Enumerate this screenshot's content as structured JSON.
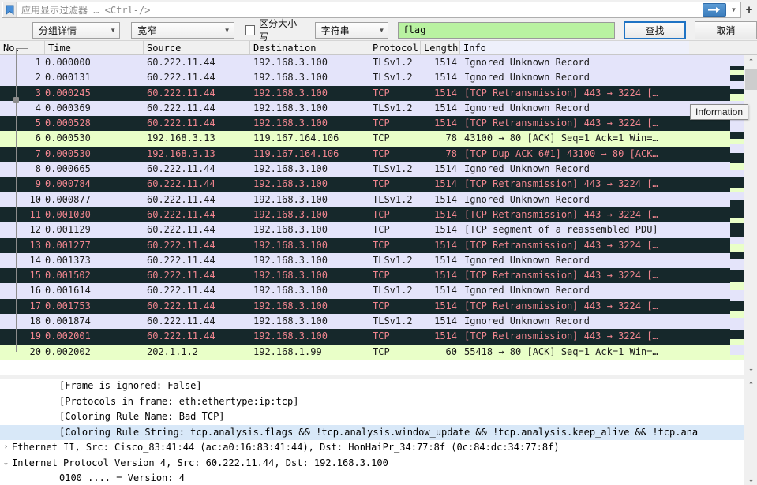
{
  "filter_bar": {
    "placeholder": "应用显示过滤器 … <Ctrl-/>",
    "bookmark_icon": "bookmark-icon",
    "apply_icon": "arrow-right-icon",
    "caret_icon": "chevron-down-icon",
    "plus_label": "+"
  },
  "find_bar": {
    "search_in": "分组详情",
    "search_width": "宽窄",
    "case_label": "区分大小写",
    "value_type": "字符串",
    "query": "flag",
    "find_label": "查找",
    "cancel_label": "取消",
    "chevron": "⌄"
  },
  "columns": {
    "no": "No.",
    "time": "Time",
    "source": "Source",
    "destination": "Destination",
    "protocol": "Protocol",
    "length": "Length",
    "info": "Info"
  },
  "tooltip": {
    "text": "Information"
  },
  "packets": [
    {
      "no": "1",
      "time": "0.000000",
      "src": "60.222.11.44",
      "dst": "192.168.3.100",
      "proto": "TLSv1.2",
      "len": "1514",
      "info": "Ignored Unknown Record",
      "style": "row-tls"
    },
    {
      "no": "2",
      "time": "0.000131",
      "src": "60.222.11.44",
      "dst": "192.168.3.100",
      "proto": "TLSv1.2",
      "len": "1514",
      "info": "Ignored Unknown Record",
      "style": "row-tls"
    },
    {
      "no": "3",
      "time": "0.000245",
      "src": "60.222.11.44",
      "dst": "192.168.3.100",
      "proto": "TCP",
      "len": "1514",
      "info": "[TCP Retransmission] 443 → 3224 […",
      "style": "row-bad"
    },
    {
      "no": "4",
      "time": "0.000369",
      "src": "60.222.11.44",
      "dst": "192.168.3.100",
      "proto": "TLSv1.2",
      "len": "1514",
      "info": "Ignored Unknown Record",
      "style": "row-tls"
    },
    {
      "no": "5",
      "time": "0.000528",
      "src": "60.222.11.44",
      "dst": "192.168.3.100",
      "proto": "TCP",
      "len": "1514",
      "info": "[TCP Retransmission] 443 → 3224 […",
      "style": "row-bad"
    },
    {
      "no": "6",
      "time": "0.000530",
      "src": "192.168.3.13",
      "dst": "119.167.164.106",
      "proto": "TCP",
      "len": "78",
      "info": "43100 → 80 [ACK] Seq=1 Ack=1 Win=…",
      "style": "row-good"
    },
    {
      "no": "7",
      "time": "0.000530",
      "src": "192.168.3.13",
      "dst": "119.167.164.106",
      "proto": "TCP",
      "len": "78",
      "info": "[TCP Dup ACK 6#1] 43100 → 80 [ACK…",
      "style": "row-bad"
    },
    {
      "no": "8",
      "time": "0.000665",
      "src": "60.222.11.44",
      "dst": "192.168.3.100",
      "proto": "TLSv1.2",
      "len": "1514",
      "info": "Ignored Unknown Record",
      "style": "row-tls"
    },
    {
      "no": "9",
      "time": "0.000784",
      "src": "60.222.11.44",
      "dst": "192.168.3.100",
      "proto": "TCP",
      "len": "1514",
      "info": "[TCP Retransmission] 443 → 3224 […",
      "style": "row-bad"
    },
    {
      "no": "10",
      "time": "0.000877",
      "src": "60.222.11.44",
      "dst": "192.168.3.100",
      "proto": "TLSv1.2",
      "len": "1514",
      "info": "Ignored Unknown Record",
      "style": "row-tls"
    },
    {
      "no": "11",
      "time": "0.001030",
      "src": "60.222.11.44",
      "dst": "192.168.3.100",
      "proto": "TCP",
      "len": "1514",
      "info": "[TCP Retransmission] 443 → 3224 […",
      "style": "row-bad"
    },
    {
      "no": "12",
      "time": "0.001129",
      "src": "60.222.11.44",
      "dst": "192.168.3.100",
      "proto": "TCP",
      "len": "1514",
      "info": "[TCP segment of a reassembled PDU]",
      "style": "row-pdu"
    },
    {
      "no": "13",
      "time": "0.001277",
      "src": "60.222.11.44",
      "dst": "192.168.3.100",
      "proto": "TCP",
      "len": "1514",
      "info": "[TCP Retransmission] 443 → 3224 […",
      "style": "row-bad"
    },
    {
      "no": "14",
      "time": "0.001373",
      "src": "60.222.11.44",
      "dst": "192.168.3.100",
      "proto": "TLSv1.2",
      "len": "1514",
      "info": "Ignored Unknown Record",
      "style": "row-tls"
    },
    {
      "no": "15",
      "time": "0.001502",
      "src": "60.222.11.44",
      "dst": "192.168.3.100",
      "proto": "TCP",
      "len": "1514",
      "info": "[TCP Retransmission] 443 → 3224 […",
      "style": "row-bad"
    },
    {
      "no": "16",
      "time": "0.001614",
      "src": "60.222.11.44",
      "dst": "192.168.3.100",
      "proto": "TLSv1.2",
      "len": "1514",
      "info": "Ignored Unknown Record",
      "style": "row-tls"
    },
    {
      "no": "17",
      "time": "0.001753",
      "src": "60.222.11.44",
      "dst": "192.168.3.100",
      "proto": "TCP",
      "len": "1514",
      "info": "[TCP Retransmission] 443 → 3224 […",
      "style": "row-bad"
    },
    {
      "no": "18",
      "time": "0.001874",
      "src": "60.222.11.44",
      "dst": "192.168.3.100",
      "proto": "TLSv1.2",
      "len": "1514",
      "info": "Ignored Unknown Record",
      "style": "row-tls"
    },
    {
      "no": "19",
      "time": "0.002001",
      "src": "60.222.11.44",
      "dst": "192.168.3.100",
      "proto": "TCP",
      "len": "1514",
      "info": "[TCP Retransmission] 443 → 3224 […",
      "style": "row-bad"
    },
    {
      "no": "20",
      "time": "0.002002",
      "src": "202.1.1.2",
      "dst": "192.168.1.99",
      "proto": "TCP",
      "len": "60",
      "info": "55418 → 80 [ACK] Seq=1 Ack=1 Win=…",
      "style": "row-good"
    }
  ],
  "detail": {
    "rows": [
      {
        "text": "[Frame is ignored: False]",
        "indent": "ind-2",
        "twisty": "",
        "selected": false
      },
      {
        "text": "[Protocols in frame: eth:ethertype:ip:tcp]",
        "indent": "ind-2",
        "twisty": "",
        "selected": false
      },
      {
        "text": "[Coloring Rule Name: Bad TCP]",
        "indent": "ind-2",
        "twisty": "",
        "selected": false
      },
      {
        "text": "[Coloring Rule String: tcp.analysis.flags && !tcp.analysis.window_update && !tcp.analysis.keep_alive && !tcp.ana",
        "indent": "ind-2",
        "twisty": "",
        "selected": true
      },
      {
        "text": "Ethernet II, Src: Cisco_83:41:44 (ac:a0:16:83:41:44), Dst: HonHaiPr_34:77:8f (0c:84:dc:34:77:8f)",
        "indent": "",
        "twisty": "›",
        "selected": false
      },
      {
        "text": "Internet Protocol Version 4, Src: 60.222.11.44, Dst: 192.168.3.100",
        "indent": "",
        "twisty": "⌄",
        "selected": false
      },
      {
        "text": "0100 .... = Version: 4",
        "indent": "ind-2",
        "twisty": "",
        "selected": false
      }
    ]
  },
  "scroll": {
    "up": "⌃",
    "down": "⌄"
  },
  "minimap": [
    {
      "color": "#e4e4fa",
      "h": 14
    },
    {
      "color": "#16282b",
      "h": 5
    },
    {
      "color": "#e9ffc8",
      "h": 6
    },
    {
      "color": "#16282b",
      "h": 8
    },
    {
      "color": "#e4e4fa",
      "h": 10
    },
    {
      "color": "#16282b",
      "h": 6
    },
    {
      "color": "#e9ffc8",
      "h": 9
    },
    {
      "color": "#e4e4fa",
      "h": 12
    },
    {
      "color": "#16282b",
      "h": 7
    },
    {
      "color": "#e9ffc8",
      "h": 5
    },
    {
      "color": "#e4e4fa",
      "h": 15
    },
    {
      "color": "#16282b",
      "h": 9
    },
    {
      "color": "#e9ffc8",
      "h": 7
    },
    {
      "color": "#e4e4fa",
      "h": 11
    },
    {
      "color": "#16282b",
      "h": 13
    },
    {
      "color": "#e9ffc8",
      "h": 8
    },
    {
      "color": "#e4e4fa",
      "h": 9
    },
    {
      "color": "#16282b",
      "h": 14
    },
    {
      "color": "#e9ffc8",
      "h": 6
    },
    {
      "color": "#e4e4fa",
      "h": 10
    },
    {
      "color": "#16282b",
      "h": 22
    },
    {
      "color": "#e9ffc8",
      "h": 7
    },
    {
      "color": "#16282b",
      "h": 18
    },
    {
      "color": "#e4e4fa",
      "h": 8
    },
    {
      "color": "#e9ffc8",
      "h": 11
    },
    {
      "color": "#16282b",
      "h": 9
    },
    {
      "color": "#e4e4fa",
      "h": 13
    },
    {
      "color": "#16282b",
      "h": 16
    },
    {
      "color": "#e9ffc8",
      "h": 10
    },
    {
      "color": "#e4e4fa",
      "h": 14
    },
    {
      "color": "#16282b",
      "h": 12
    },
    {
      "color": "#e9ffc8",
      "h": 9
    },
    {
      "color": "#e4e4fa",
      "h": 16
    },
    {
      "color": "#16282b",
      "h": 11
    },
    {
      "color": "#e9ffc8",
      "h": 8
    },
    {
      "color": "#e4e4fa",
      "h": 12
    }
  ]
}
